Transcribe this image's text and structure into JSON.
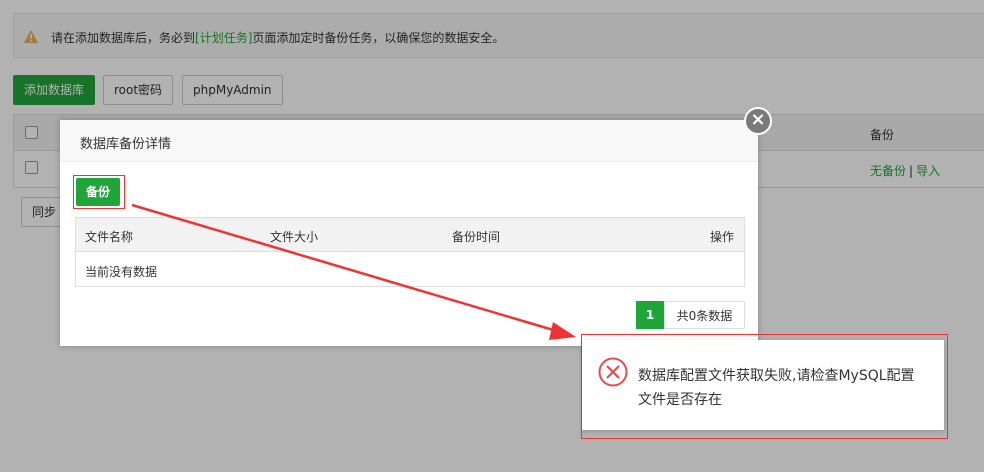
{
  "notice": {
    "text_before": "请在添加数据库后，务必到",
    "link": "[计划任务]",
    "text_after": "页面添加定时备份任务，以确保您的数据安全。"
  },
  "toolbar": {
    "add_db": "添加数据库",
    "root_pwd": "root密码",
    "phpmyadmin": "phpMyAdmin",
    "sync": "同步"
  },
  "db_table": {
    "col_backup": "备份",
    "row_no_backup": "无备份",
    "row_sep": "|",
    "row_import": "导入"
  },
  "modal": {
    "title": "数据库备份详情",
    "close": "×",
    "backup_button": "备份",
    "columns": [
      "文件名称",
      "文件大小",
      "备份时间",
      "操作"
    ],
    "empty_text": "当前没有数据",
    "pager": {
      "page": "1",
      "total": "共0条数据"
    }
  },
  "error_toast": {
    "line1": "数据库配置文件获取失败,请检查MySQL配置",
    "line2": "文件是否存在"
  },
  "colors": {
    "accent": "#20a53a",
    "annotation": "#ee3333",
    "error": "#e84c4c"
  }
}
